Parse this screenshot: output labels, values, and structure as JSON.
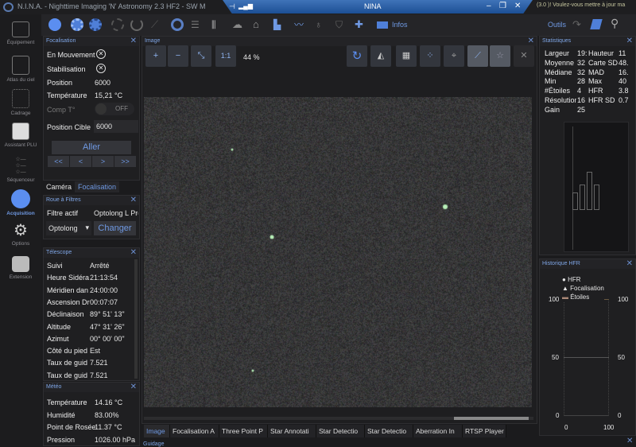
{
  "window": {
    "app_title": "N.I.N.A. - Nighttime Imaging 'N' Astronomy 2.3 HF2  -  SW M",
    "remote_title": "NINA",
    "notification": "(3.0 )! Voulez-vous mettre à jour ma",
    "minimize": "–",
    "restore": "❐",
    "close": "✕"
  },
  "toolbar": {
    "infos": "Infos",
    "outils": "Outils"
  },
  "nav": [
    {
      "label": "Équipement"
    },
    {
      "label": "Atlas du ciel"
    },
    {
      "label": "Cadrage"
    },
    {
      "label": "Assistant PLU"
    },
    {
      "label": "Séquenceur"
    },
    {
      "label": "Acquisition",
      "active": true
    },
    {
      "label": "Options"
    },
    {
      "label": "Extension"
    }
  ],
  "focuser": {
    "title": "Focalisation",
    "moving_label": "En Mouvement",
    "settling_label": "Stabilisation",
    "position_label": "Position",
    "position": "6000",
    "temp_label": "Température",
    "temp": "15,21 °C",
    "comp_label": "Comp T°",
    "comp_state": "OFF",
    "target_label": "Position Cible",
    "target": "6000",
    "go": "Aller",
    "steps": [
      "<<",
      "<",
      ">",
      ">>"
    ]
  },
  "tabs_left": [
    "Caméra",
    "Focalisation"
  ],
  "filter": {
    "title": "Roue à Filtres",
    "active_label": "Filtre actif",
    "active": "Optolong L Pro",
    "select": "Optolong",
    "change": "Changer"
  },
  "telescope": {
    "title": "Télescope",
    "rows": [
      [
        "Suivi",
        "Arrêté"
      ],
      [
        "Heure Sidéra",
        "21:13:54"
      ],
      [
        "Méridien dan",
        "24:00:00"
      ],
      [
        "Ascension Dr",
        "00:07:07"
      ],
      [
        "Déclinaison",
        "89° 51' 13\""
      ],
      [
        "Altitude",
        "47° 31' 26\""
      ],
      [
        "Azimut",
        "00° 00' 00\""
      ],
      [
        "Côté du pied",
        "Est"
      ],
      [
        "Taux de guid",
        "7.521"
      ],
      [
        "Taux de guid",
        "7.521"
      ]
    ]
  },
  "weather": {
    "title": "Météo",
    "rows": [
      [
        "Température",
        "14.16 °C"
      ],
      [
        "Humidité",
        "83.00%"
      ],
      [
        "Point de Rosée",
        "11.37 °C"
      ],
      [
        "Pression",
        "1026.00 hPa"
      ]
    ]
  },
  "image": {
    "title": "Image",
    "zoom_in": "+",
    "zoom_out": "−",
    "fit": "⤡",
    "one_to_one": "1:1",
    "zoom": "44 %"
  },
  "bottom_tabs": [
    "Image",
    "Focalisation A",
    "Three Point P",
    "Star Annotati",
    "Star Detectio",
    "Star Detectio",
    "Aberration In",
    "RTSP Player"
  ],
  "guiding_title": "Guidage",
  "stats": {
    "title": "Statistiques",
    "rows": [
      [
        "Largeur",
        "19:",
        "Hauteur",
        "11"
      ],
      [
        "Moyenne",
        "32",
        "Carte SD",
        "48."
      ],
      [
        "Médiane",
        "32",
        "MAD",
        "16."
      ],
      [
        "Min",
        "28",
        "Max",
        "40"
      ],
      [
        "#Étoiles",
        "4",
        "HFR",
        "3.8"
      ],
      [
        "Résolution",
        "16",
        "HFR SD",
        "0.7"
      ],
      [
        "Gain",
        "25",
        "",
        ""
      ]
    ]
  },
  "hfr": {
    "title": "Historique HFR",
    "legend": [
      "HFR",
      "Focalisation",
      "Étoiles"
    ],
    "y_left": [
      "100",
      "50",
      "0"
    ],
    "y_right": [
      "100",
      "50",
      "0"
    ],
    "x": [
      "0",
      "100"
    ]
  }
}
